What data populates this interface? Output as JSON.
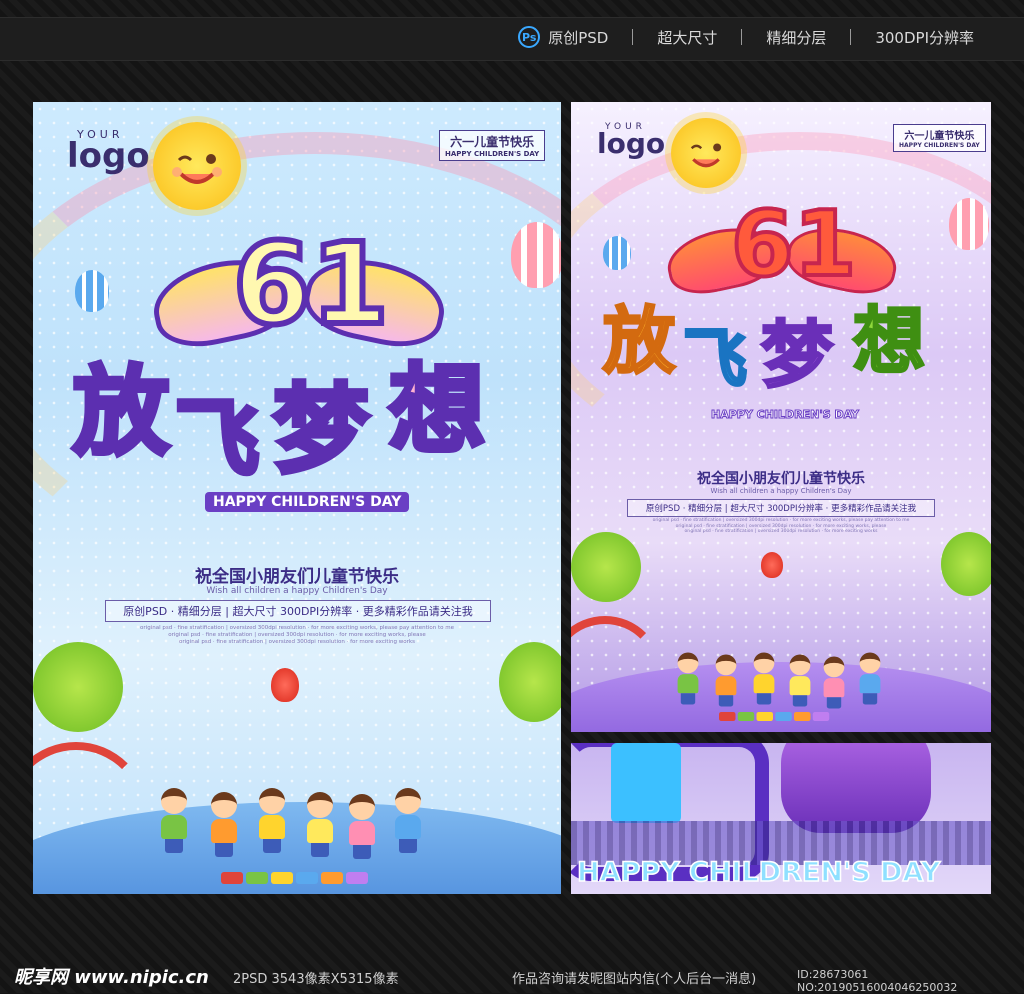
{
  "header": {
    "ps_icon": "Ps",
    "features": [
      "原创PSD",
      "超大尺寸",
      "精细分层",
      "300DPI分辨率"
    ]
  },
  "poster": {
    "logo_your": "YOUR",
    "logo_word": "logo",
    "tag_cn": "六一儿童节快乐",
    "tag_en": "HAPPY CHILDREN'S DAY",
    "number": "61",
    "title_chars": [
      "放",
      "飞",
      "梦",
      "想"
    ],
    "subtitle_en": "HAPPY CHILDREN'S DAY",
    "slogan": "祝全国小朋友们儿童节快乐",
    "slogan_en": "Wish all children a happy Children's Day",
    "info_line": "原创PSD · 精细分层 | 超大尺寸  300DPI分辨率 · 更多精彩作品请关注我",
    "fine_print": [
      "original psd  ·  fine stratification  |  oversized 300dpi resolution  ·  for more exciting works, please pay attention to me",
      "original psd  ·  fine stratification  |  oversized 300dpi resolution  ·  for more exciting works, please",
      "original psd  ·  fine stratification  |  oversized 300dpi resolution  ·  for more exciting works"
    ]
  },
  "detail_crop": {
    "text": "HAPPY CHILDREN'S DAY"
  },
  "footer": {
    "site_logo": "昵享网 www.nipic.cn",
    "file_info": "2PSD  3543像素X5315像素",
    "contact": "作品咨询请发昵图站内信(个人后台一消息)",
    "id": "ID:28673061 NO:20190516004046250032"
  },
  "colors": {
    "poster1_bg": "#c3e4fc",
    "poster2_bg": "#dcc9f6",
    "text_purple": "#3b2c86"
  }
}
